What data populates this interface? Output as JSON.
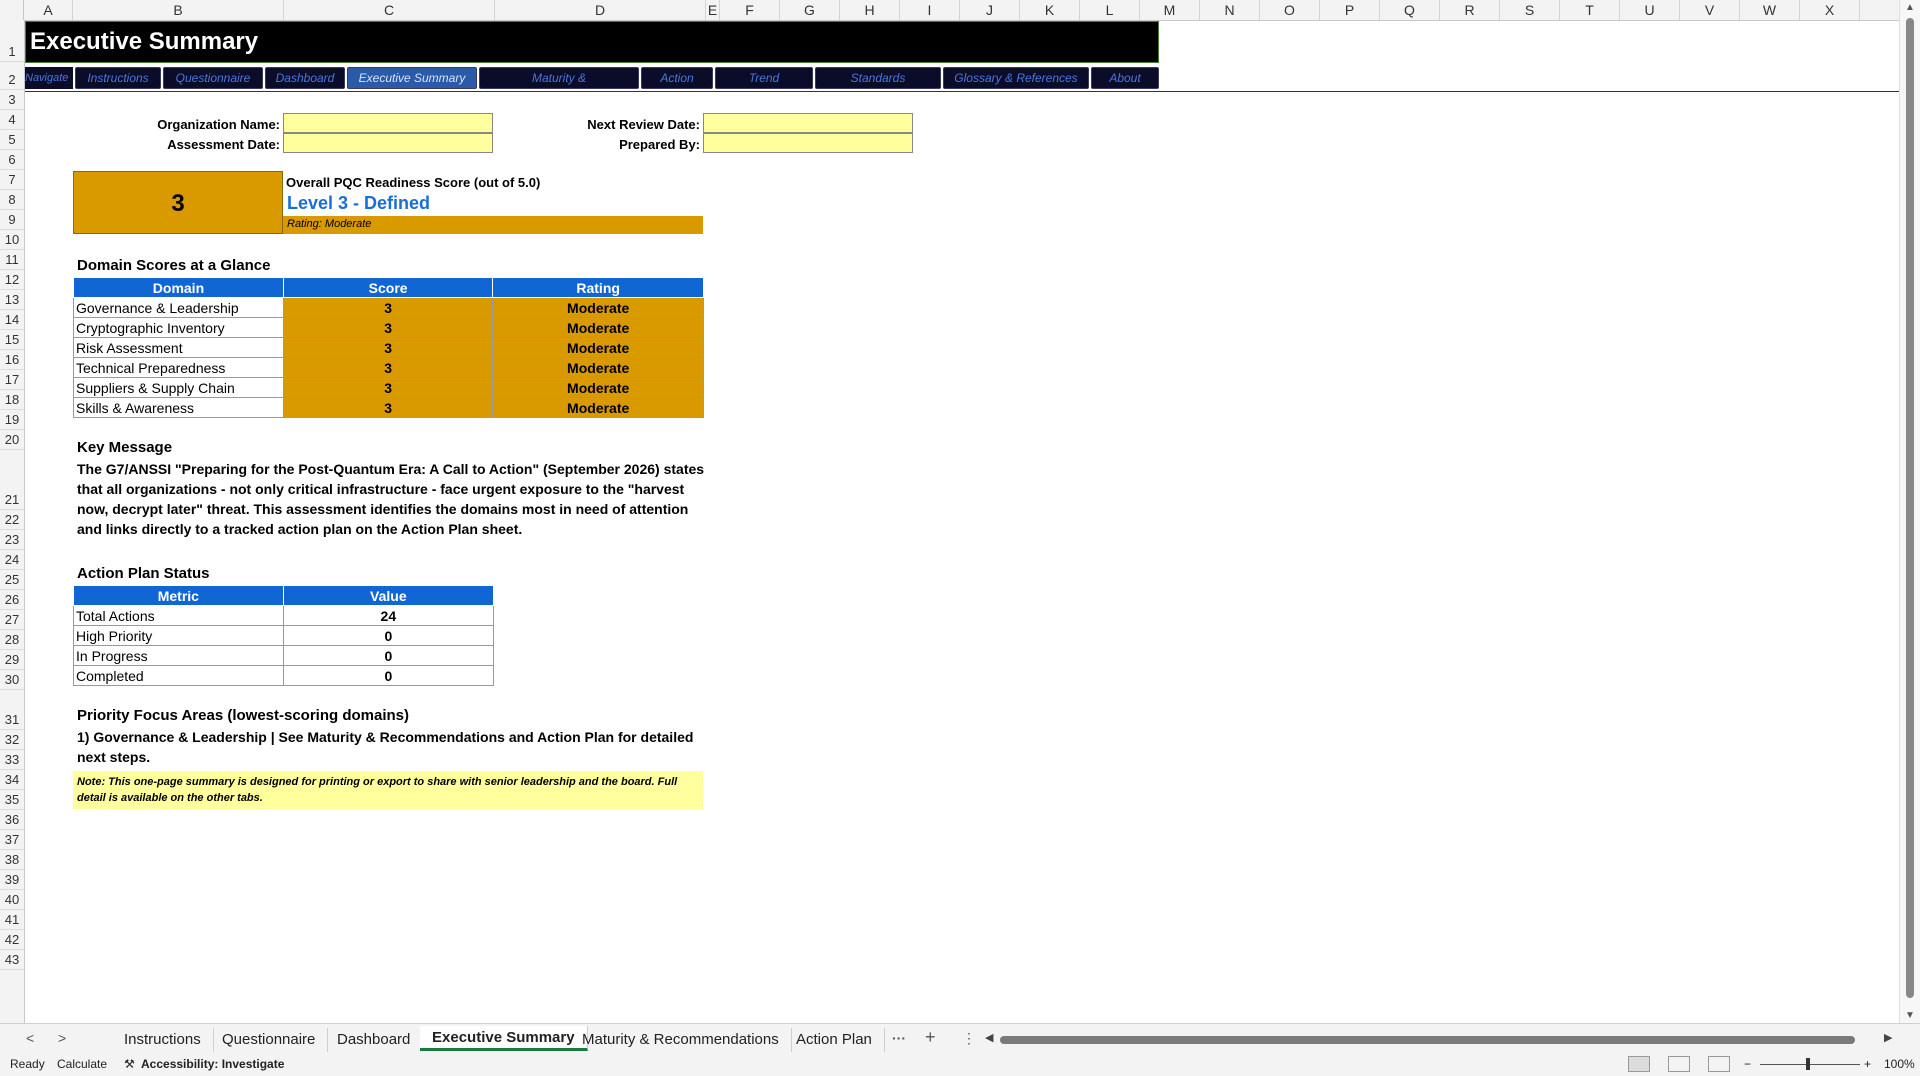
{
  "columns": [
    "A",
    "B",
    "C",
    "D",
    "E",
    "F",
    "G",
    "H",
    "I",
    "J",
    "K",
    "L",
    "M",
    "N",
    "O",
    "P",
    "Q",
    "R",
    "S",
    "T",
    "U",
    "V",
    "W",
    "X"
  ],
  "rows": [
    "1",
    "2",
    "3",
    "4",
    "5",
    "6",
    "7",
    "8",
    "9",
    "10",
    "11",
    "12",
    "13",
    "14",
    "15",
    "16",
    "17",
    "18",
    "19",
    "20",
    "21",
    "22",
    "23",
    "24",
    "25",
    "26",
    "27",
    "28",
    "29",
    "30",
    "31",
    "32",
    "33",
    "34",
    "35",
    "36",
    "37",
    "38",
    "39",
    "40",
    "41",
    "42",
    "43"
  ],
  "title": "Executive Summary",
  "nav": {
    "label": "Navigate",
    "buttons": [
      "Instructions",
      "Questionnaire",
      "Dashboard",
      "Executive Summary",
      "Maturity &",
      "Action",
      "Trend",
      "Standards",
      "Glossary & References",
      "About"
    ]
  },
  "form": {
    "org_name_label": "Organization Name:",
    "assessment_date_label": "Assessment Date:",
    "next_review_label": "Next Review Date:",
    "prepared_by_label": "Prepared By:"
  },
  "overall": {
    "score": "3",
    "label": "Overall PQC Readiness Score (out of 5.0)",
    "level": "Level 3 - Defined",
    "rating": "Rating: Moderate"
  },
  "domains": {
    "heading": "Domain Scores at a Glance",
    "headers": [
      "Domain",
      "Score",
      "Rating"
    ],
    "rows": [
      [
        "Governance & Leadership",
        "3",
        "Moderate"
      ],
      [
        "Cryptographic Inventory",
        "3",
        "Moderate"
      ],
      [
        "Risk Assessment",
        "3",
        "Moderate"
      ],
      [
        "Technical Preparedness",
        "3",
        "Moderate"
      ],
      [
        "Suppliers & Supply Chain",
        "3",
        "Moderate"
      ],
      [
        "Skills & Awareness",
        "3",
        "Moderate"
      ]
    ]
  },
  "key_message": {
    "heading": "Key Message",
    "text": "The G7/ANSSI \"Preparing for the Post-Quantum Era: A Call to Action\" (September 2026) states that all organizations - not only critical infrastructure - face urgent exposure to the \"harvest now, decrypt later\" threat. This assessment identifies the domains most in need of attention and links directly to a tracked action plan on the Action Plan sheet."
  },
  "action_plan": {
    "heading": "Action Plan Status",
    "headers": [
      "Metric",
      "Value"
    ],
    "rows": [
      [
        "Total Actions",
        "24"
      ],
      [
        "High Priority",
        "0"
      ],
      [
        "In Progress",
        "0"
      ],
      [
        "Completed",
        "0"
      ]
    ]
  },
  "priority": {
    "heading": "Priority Focus Areas (lowest-scoring domains)",
    "text": "1) Governance & Leadership  |  See Maturity & Recommendations and Action Plan for detailed next steps.",
    "note": "Note: This one-page summary is designed for printing or export to share with senior leadership and the board. Full detail is available on the other tabs."
  },
  "sheet_tabs": [
    "Instructions",
    "Questionnaire",
    "Dashboard",
    "Executive Summary",
    "Maturity & Recommendations",
    "Action Plan"
  ],
  "sheet_tab_more": "···",
  "sheet_tab_add": "+",
  "status": {
    "ready": "Ready",
    "calculate": "Calculate",
    "accessibility": "Accessibility: Investigate",
    "zoom": "100%"
  }
}
